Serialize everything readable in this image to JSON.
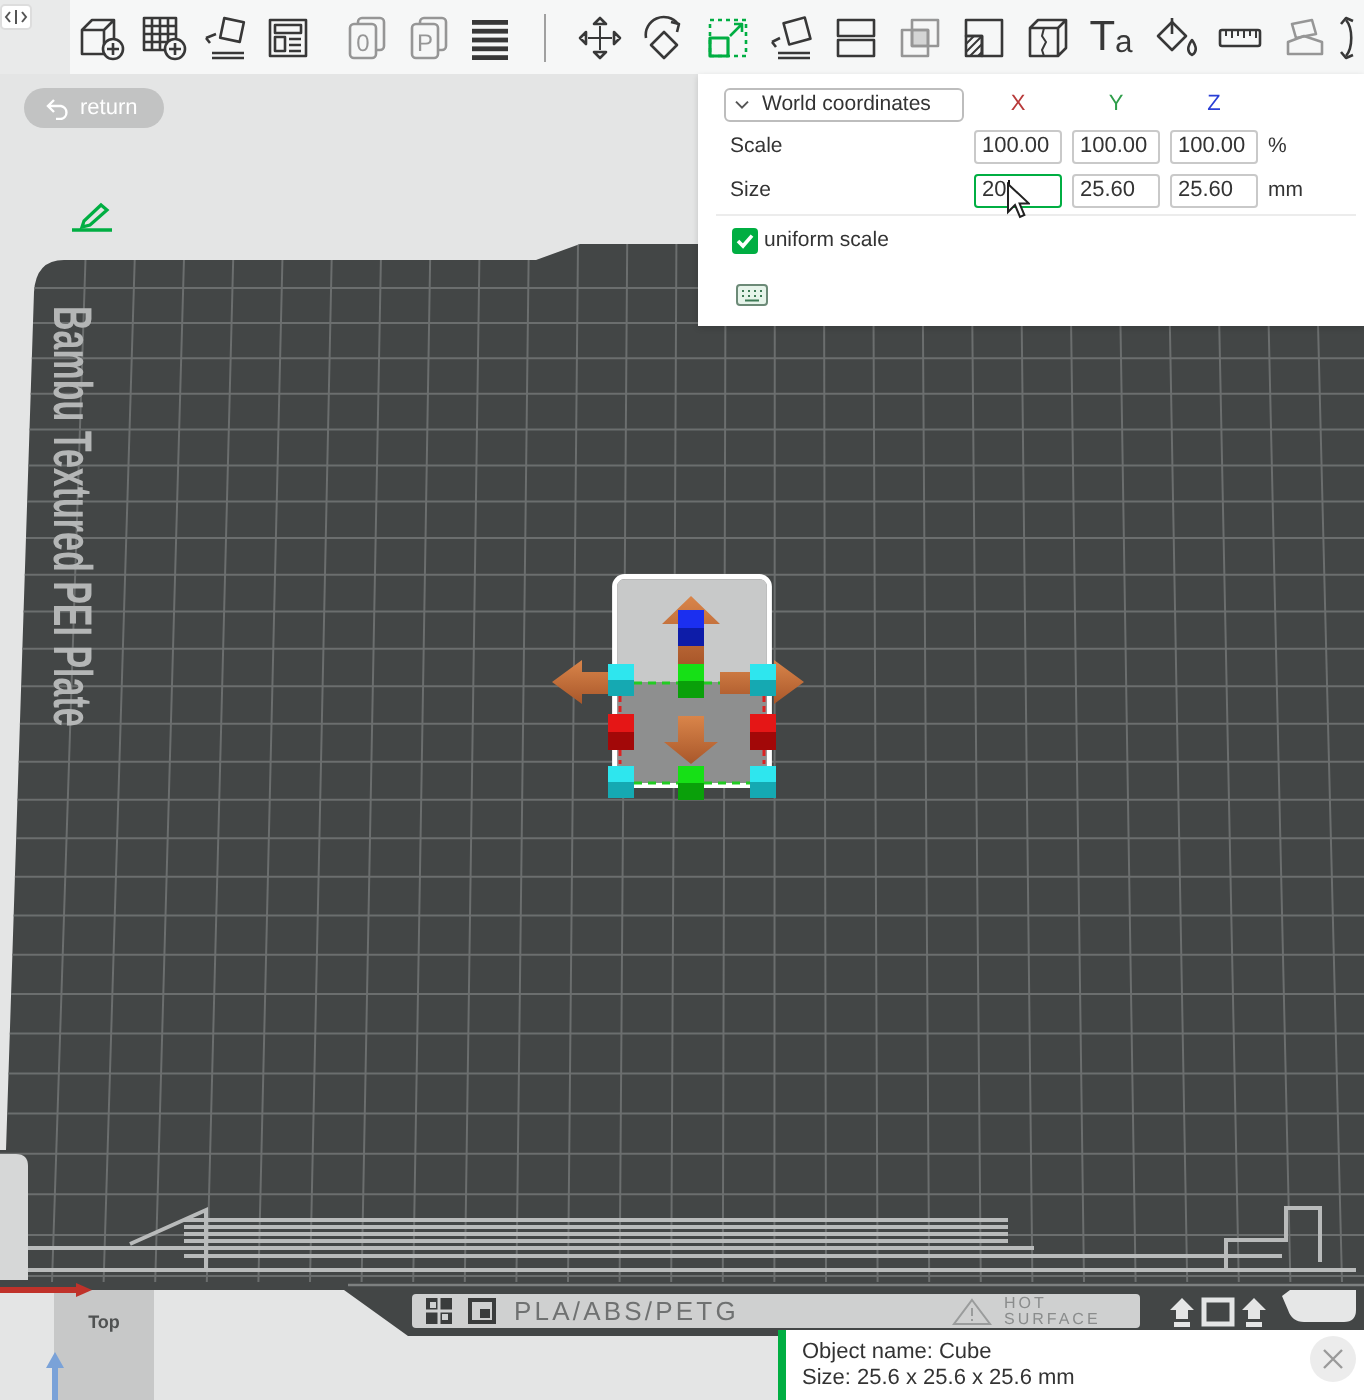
{
  "toolbar": {
    "buttons": [
      {
        "selected": false,
        "disabled": false
      },
      {
        "selected": false,
        "disabled": false
      },
      {
        "selected": false,
        "disabled": false
      },
      {
        "selected": false,
        "disabled": false
      },
      {
        "selected": false,
        "disabled": true,
        "glyph": "0"
      },
      {
        "selected": false,
        "disabled": true,
        "glyph": "P"
      },
      {
        "selected": false,
        "disabled": false
      },
      {
        "selected": false,
        "disabled": false
      },
      {
        "selected": false,
        "disabled": false
      },
      {
        "selected": true,
        "disabled": false
      },
      {
        "selected": false,
        "disabled": false
      },
      {
        "selected": false,
        "disabled": false
      },
      {
        "selected": false,
        "disabled": true
      },
      {
        "selected": false,
        "disabled": false
      },
      {
        "selected": false,
        "disabled": false
      },
      {
        "selected": false,
        "disabled": false,
        "glyph": "T$_{a}$"
      },
      {
        "selected": false,
        "disabled": false
      },
      {
        "selected": false,
        "disabled": false
      },
      {
        "selected": false,
        "disabled": true
      },
      {
        "selected": false,
        "disabled": false
      }
    ]
  },
  "return_button": {
    "label": "return"
  },
  "plate": {
    "name": "Bambu Textured PEI Plate",
    "material": "PLA/ABS/PETG",
    "warning": "HOT SURFACE"
  },
  "transform_panel": {
    "coordinates": {
      "value": "World coordinates"
    },
    "axes": [
      {
        "label": "X",
        "color": "#b83a3a"
      },
      {
        "label": "Y",
        "color": "#2e9e4a"
      },
      {
        "label": "Z",
        "color": "#2a3fd6"
      }
    ],
    "rows": [
      {
        "label": "Scale",
        "fields": [
          {
            "value": "100.00",
            "focused": false
          },
          {
            "value": "100.00",
            "focused": false
          },
          {
            "value": "100.00",
            "focused": false
          }
        ],
        "unit": "%"
      },
      {
        "label": "Size",
        "fields": [
          {
            "value": "20",
            "focused": true
          },
          {
            "value": "25.60",
            "focused": false
          },
          {
            "value": "25.60",
            "focused": false
          }
        ],
        "unit": "mm"
      }
    ],
    "uniform_scale": {
      "label": "uniform scale",
      "checked": true
    }
  },
  "view_cube": {
    "label": "Top"
  },
  "notification": {
    "lines": [
      "Object name: Cube",
      "Size: 25.6 x 25.6 x 25.6 mm"
    ]
  }
}
